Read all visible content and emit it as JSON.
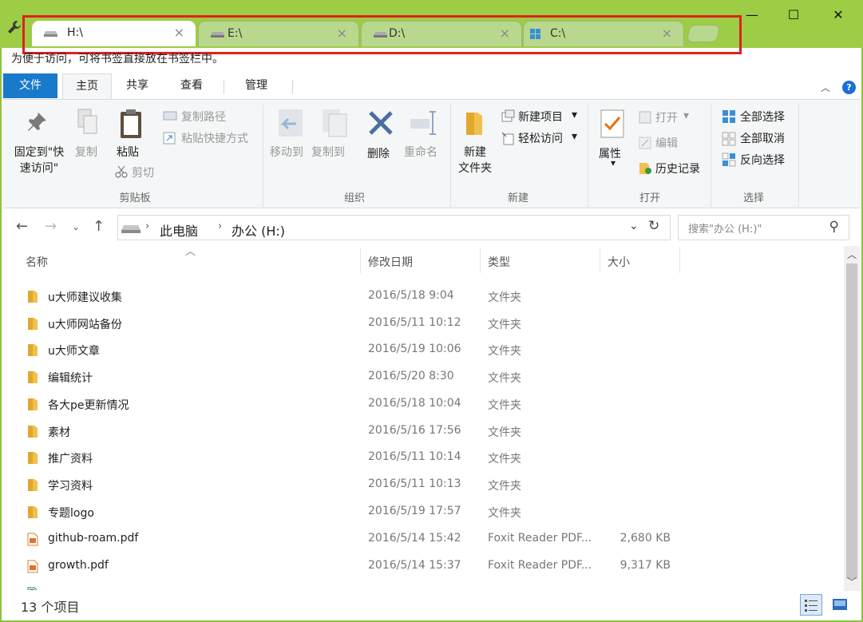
{
  "window": {
    "minimize_glyph": "—",
    "maximize_glyph": "☐",
    "close_glyph": "✕"
  },
  "tabs": [
    {
      "label": "H:\\",
      "active": true,
      "icon": "drive-icon"
    },
    {
      "label": "E:\\",
      "active": false,
      "icon": "drive-icon"
    },
    {
      "label": "D:\\",
      "active": false,
      "icon": "drive-icon"
    },
    {
      "label": "C:\\",
      "active": false,
      "icon": "windows-drive-icon"
    }
  ],
  "tab_close_glyph": "×",
  "bookmark_hint": "为便于访问，可将书签直接放在书签栏中。",
  "ribbon_tabs": {
    "file": "文件",
    "home": "主页",
    "share": "共享",
    "view": "查看",
    "manage": "管理"
  },
  "ribbon": {
    "pin_quick_access": [
      "固定到\"快",
      "速访问\""
    ],
    "copy": "复制",
    "paste": "粘贴",
    "copy_path": "复制路径",
    "paste_shortcut": "粘贴快捷方式",
    "cut": "剪切",
    "clipboard_group": "剪贴板",
    "move_to": "移动到",
    "copy_to": "复制到",
    "delete": "删除",
    "rename": "重命名",
    "organize_group": "组织",
    "new_folder": [
      "新建",
      "文件夹"
    ],
    "new_item": "新建项目",
    "easy_access": "轻松访问",
    "new_group": "新建",
    "properties": "属性",
    "open": "打开",
    "edit": "编辑",
    "history": "历史记录",
    "open_group": "打开",
    "select_all": "全部选择",
    "select_none": "全部取消",
    "invert_selection": "反向选择",
    "select_group": "选择"
  },
  "address": {
    "crumbs": [
      "此电脑",
      "办公 (H:)"
    ],
    "search_placeholder": "搜索\"办公 (H:)\""
  },
  "columns": {
    "name": "名称",
    "modified": "修改日期",
    "type": "类型",
    "size": "大小"
  },
  "files": [
    {
      "name": "u大师建议收集",
      "date": "2016/5/18 9:04",
      "type": "文件夹",
      "size": "",
      "kind": "folder"
    },
    {
      "name": "u大师网站备份",
      "date": "2016/5/11 10:12",
      "type": "文件夹",
      "size": "",
      "kind": "folder"
    },
    {
      "name": "u大师文章",
      "date": "2016/5/19 10:06",
      "type": "文件夹",
      "size": "",
      "kind": "folder"
    },
    {
      "name": "编辑统计",
      "date": "2016/5/20 8:30",
      "type": "文件夹",
      "size": "",
      "kind": "folder"
    },
    {
      "name": "各大pe更新情况",
      "date": "2016/5/18 10:04",
      "type": "文件夹",
      "size": "",
      "kind": "folder"
    },
    {
      "name": "素材",
      "date": "2016/5/16 17:56",
      "type": "文件夹",
      "size": "",
      "kind": "folder"
    },
    {
      "name": "推广资料",
      "date": "2016/5/11 10:14",
      "type": "文件夹",
      "size": "",
      "kind": "folder"
    },
    {
      "name": "学习资料",
      "date": "2016/5/11 10:13",
      "type": "文件夹",
      "size": "",
      "kind": "folder"
    },
    {
      "name": "专题logo",
      "date": "2016/5/19 17:57",
      "type": "文件夹",
      "size": "",
      "kind": "folder"
    },
    {
      "name": "github-roam.pdf",
      "date": "2016/5/14 15:42",
      "type": "Foxit Reader PDF...",
      "size": "2,680 KB",
      "kind": "pdf"
    },
    {
      "name": "growth.pdf",
      "date": "2016/5/14 15:37",
      "type": "Foxit Reader PDF...",
      "size": "9,317 KB",
      "kind": "pdf"
    }
  ],
  "status": {
    "item_count": "13 个项目"
  },
  "colors": {
    "titlebar": "#9ccd45",
    "highlight": "#e0211d",
    "file_tab": "#1979ca",
    "folder": "#f2c04e"
  }
}
